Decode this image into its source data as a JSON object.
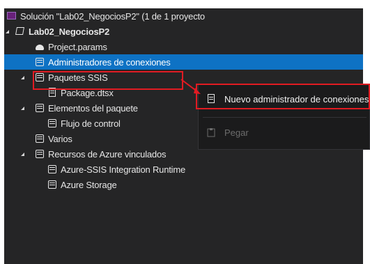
{
  "solution_explorer": {
    "items": [
      {
        "label": "Solución \"Lab02_NegociosP2\" (1 de 1 proyecto",
        "icon": "solution-icon"
      },
      {
        "label": "Lab02_NegociosP2",
        "icon": "project-icon"
      },
      {
        "label": "Project.params",
        "icon": "params-icon"
      },
      {
        "label": "Administradores de conexiones",
        "icon": "folder-icon"
      },
      {
        "label": "Paquetes SSIS",
        "icon": "folder-icon"
      },
      {
        "label": "Package.dtsx",
        "icon": "package-icon"
      },
      {
        "label": "Elementos del paquete",
        "icon": "folder-icon"
      },
      {
        "label": "Flujo de control",
        "icon": "folder-icon"
      },
      {
        "label": "Varios",
        "icon": "folder-icon"
      },
      {
        "label": "Recursos de Azure vinculados",
        "icon": "folder-icon"
      },
      {
        "label": "Azure-SSIS Integration Runtime",
        "icon": "folder-icon"
      },
      {
        "label": "Azure Storage",
        "icon": "folder-icon"
      }
    ],
    "selected_item": "Administradores de conexiones"
  },
  "context_menu": {
    "items": [
      {
        "label": "Nuevo administrador de conexiones",
        "icon": "new-connection-manager-icon",
        "enabled": true
      },
      {
        "label": "Pegar",
        "icon": "paste-icon",
        "enabled": false
      }
    ]
  },
  "colors": {
    "background": "#252526",
    "selection": "#0e72c4",
    "menu_background": "#1b1b1c",
    "text": "#e6e6e6",
    "disabled_text": "#6d6d6d",
    "highlight_box": "#e11b22"
  }
}
